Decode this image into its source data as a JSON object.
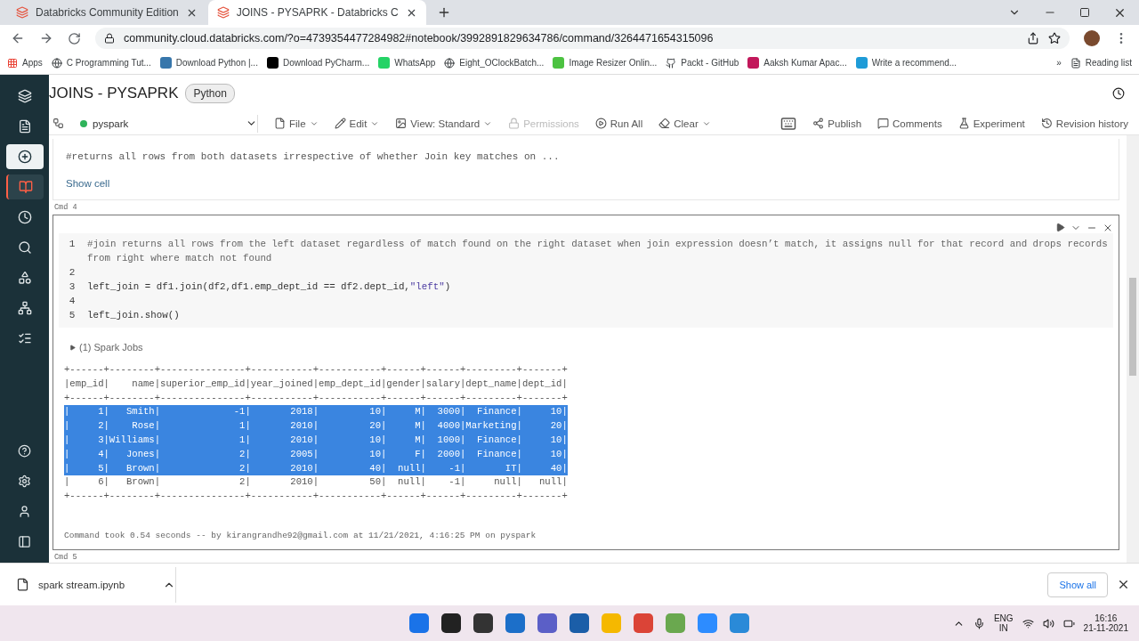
{
  "browser": {
    "tabs": [
      {
        "title": "Databricks Community Edition",
        "selected": false
      },
      {
        "title": "JOINS - PYSAPRK - Databricks C",
        "selected": true
      }
    ],
    "url": "community.cloud.databricks.com/?o=4739354477284982#notebook/3992891829634786/command/3264471654315096",
    "bookmarks": [
      {
        "label": "Apps",
        "kind": "apps"
      },
      {
        "label": "C Programming Tut...",
        "kind": "globe"
      },
      {
        "label": "Download Python |...",
        "kind": "python"
      },
      {
        "label": "Download PyCharm...",
        "kind": "jb"
      },
      {
        "label": "WhatsApp",
        "kind": "whatsapp"
      },
      {
        "label": "Eight_OClockBatch...",
        "kind": "globe"
      },
      {
        "label": "Image Resizer Onlin...",
        "kind": "resizer"
      },
      {
        "label": "Packt - GitHub",
        "kind": "github"
      },
      {
        "label": "Aaksh Kumar Apac...",
        "kind": "power"
      },
      {
        "label": "Write a recommend...",
        "kind": "u"
      }
    ],
    "more": "»",
    "reading_list": "Reading list"
  },
  "sidebar": [
    {
      "kind": "logo",
      "selected": false
    },
    {
      "kind": "docs",
      "selected": false
    },
    {
      "kind": "create",
      "selected": false
    },
    {
      "kind": "workspace",
      "selected": true
    },
    {
      "kind": "recents",
      "selected": false
    },
    {
      "kind": "search",
      "selected": false
    },
    {
      "kind": "data",
      "selected": false
    },
    {
      "kind": "compute",
      "selected": false
    },
    {
      "kind": "jobs",
      "selected": false
    }
  ],
  "sidebar_bottom": [
    {
      "kind": "help"
    },
    {
      "kind": "settings"
    },
    {
      "kind": "account"
    },
    {
      "kind": "collapse"
    }
  ],
  "notebook": {
    "title": "JOINS - PYSAPRK",
    "language": "Python",
    "cluster": "pyspark",
    "toolbar_left": [
      {
        "label": "File",
        "kind": "file",
        "disabled": false
      },
      {
        "label": "Edit",
        "kind": "edit",
        "disabled": false
      },
      {
        "label": "View: Standard",
        "kind": "view",
        "disabled": false
      },
      {
        "label": "Permissions",
        "kind": "lock",
        "disabled": true
      },
      {
        "label": "Run All",
        "kind": "run",
        "disabled": false
      },
      {
        "label": "Clear",
        "kind": "clear",
        "disabled": false
      }
    ],
    "toolbar_right": [
      {
        "label": "Publish",
        "kind": "publish"
      },
      {
        "label": "Comments",
        "kind": "comments"
      },
      {
        "label": "Experiment",
        "kind": "experiment"
      },
      {
        "label": "Revision history",
        "kind": "history"
      }
    ],
    "hidden_cell": {
      "preview": "#returns all rows from both datasets irrespective of whether Join key matches on ...",
      "link": "Show cell"
    },
    "cell": {
      "label": "Cmd 4",
      "code": [
        {
          "number": "1",
          "segments": [
            {
              "text": "#join returns all rows from the left dataset regardless of match found on the right dataset when join expression doesn’t match, it assigns null for that record and drops records from right where match not found",
              "kind": "comment"
            }
          ]
        },
        {
          "number": "2"
        },
        {
          "number": "3",
          "segments": [
            {
              "text": "left_join = df1.join(df2,df1.emp_dept_id == df2.dept_id,",
              "kind": "plain"
            },
            {
              "text": "\"left\"",
              "kind": "string"
            },
            {
              "text": ")",
              "kind": "plain"
            }
          ]
        },
        {
          "number": "4"
        },
        {
          "number": "5",
          "segments": [
            {
              "text": "left_join.show()",
              "kind": "plain"
            }
          ]
        }
      ],
      "jobs": "(1) Spark Jobs",
      "output": [
        {
          "text": "+------+--------+---------------+-----------+-----------+------+------+---------+-------+",
          "selected": false
        },
        {
          "text": "|emp_id|    name|superior_emp_id|year_joined|emp_dept_id|gender|salary|dept_name|dept_id|",
          "selected": false
        },
        {
          "text": "+------+--------+---------------+-----------+-----------+------+------+---------+-------+",
          "selected": false
        },
        {
          "text": "|     1|   Smith|             -1|       2018|         10|     M|  3000|  Finance|     10|",
          "selected": true
        },
        {
          "text": "|     2|    Rose|              1|       2010|         20|     M|  4000|Marketing|     20|",
          "selected": true
        },
        {
          "text": "|     3|Williams|              1|       2010|         10|     M|  1000|  Finance|     10|",
          "selected": true
        },
        {
          "text": "|     4|   Jones|              2|       2005|         10|     F|  2000|  Finance|     10|",
          "selected": true
        },
        {
          "text": "|     5|   Brown|              2|       2010|         40|  null|    -1|       IT|     40|",
          "selected": true
        },
        {
          "text": "|     6|   Brown|              2|       2010|         50|  null|    -1|     null|   null|",
          "selected": false
        },
        {
          "text": "+------+--------+---------------+-----------+-----------+------+------+---------+-------+",
          "selected": false
        }
      ],
      "footer": "Command took 0.54 seconds -- by kirangrandhe92@gmail.com at 11/21/2021, 4:16:25 PM on pyspark"
    },
    "next_label": "Cmd 5"
  },
  "download": {
    "file": "spark stream.ipynb",
    "show_all": "Show all"
  },
  "taskbar": {
    "lang": "ENG",
    "region": "IN",
    "time": "16:16",
    "date": "21-11-2021"
  }
}
